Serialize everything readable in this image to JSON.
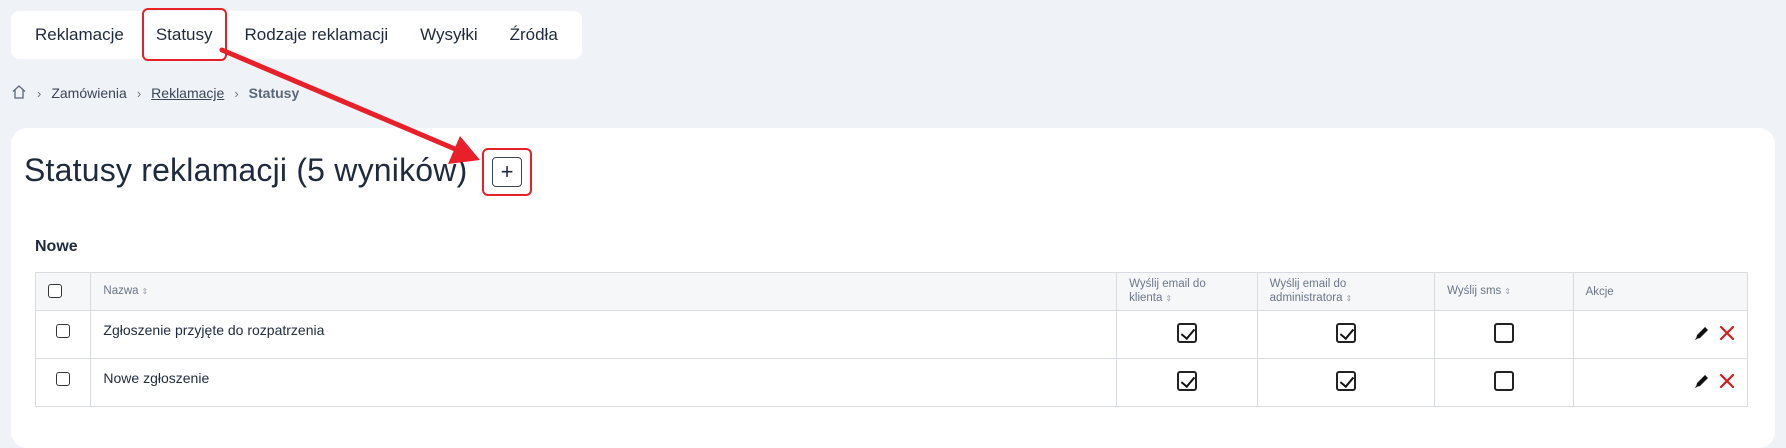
{
  "tabs": [
    {
      "label": "Reklamacje"
    },
    {
      "label": "Statusy"
    },
    {
      "label": "Rodzaje reklamacji"
    },
    {
      "label": "Wysyłki"
    },
    {
      "label": "Źródła"
    }
  ],
  "breadcrumb": {
    "home_icon": "home-icon",
    "items": [
      "Zamówienia",
      "Reklamacje",
      "Statusy"
    ]
  },
  "page": {
    "title": "Statusy reklamacji (5 wyników)",
    "add_label": "+",
    "section": "Nowe"
  },
  "table": {
    "headers": {
      "name": "Nazwa",
      "email_client": "Wyślij email do klienta",
      "email_admin": "Wyślij email do administratora",
      "sms": "Wyślij sms",
      "actions": "Akcje"
    },
    "rows": [
      {
        "name": "Zgłoszenie przyjęte do rozpatrzenia",
        "email_client": true,
        "email_admin": true,
        "sms": false
      },
      {
        "name": "Nowe zgłoszenie",
        "email_client": true,
        "email_admin": true,
        "sms": false
      }
    ]
  },
  "colors": {
    "highlight": "#e8202a",
    "delete": "#cc1f1f"
  }
}
